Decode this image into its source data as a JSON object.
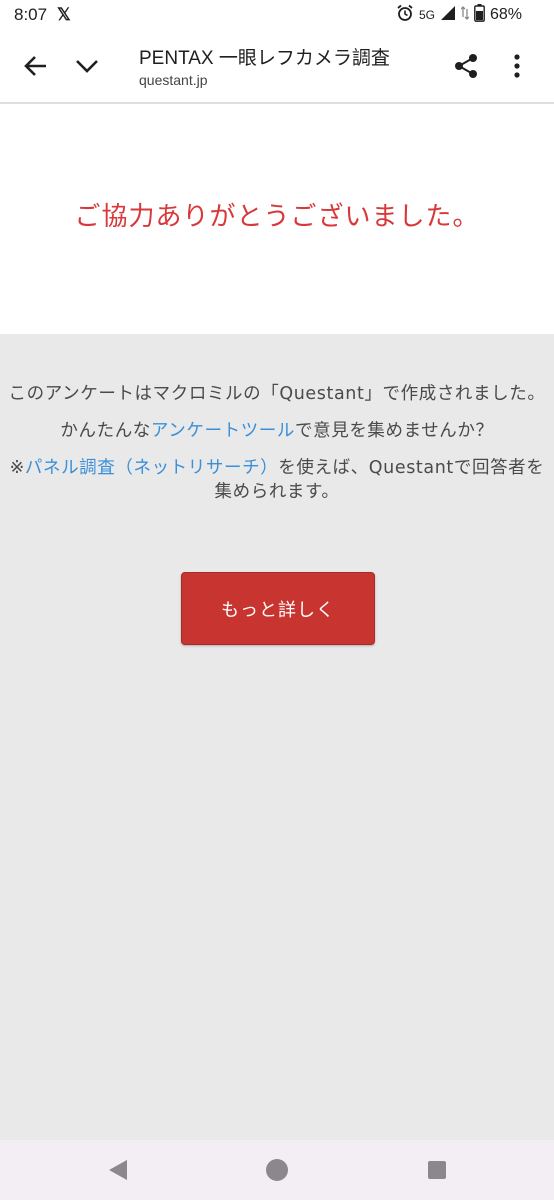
{
  "status_bar": {
    "time": "8:07",
    "x_app": "𝕏",
    "network": "5G",
    "battery": "68%",
    "battery_level": 0.68
  },
  "header": {
    "title": "PENTAX 一眼レフカメラ調査",
    "url": "questant.jp",
    "icons": [
      "arrow-back-icon",
      "chevron-down-icon",
      "share-icon",
      "more-vert-icon"
    ]
  },
  "thanks": {
    "message": "ご協力ありがとうございました。"
  },
  "info": {
    "line1": "このアンケートはマクロミルの「Questant」で作成されました。",
    "line2_pre": "かんたんな",
    "line2_link": "アンケートツール",
    "line2_post": "で意見を集めませんか？",
    "line3_pre": "※",
    "line3_link": "パネル調査（ネットリサーチ）",
    "line3_post": "を使えば、Questantで回答者を集められます。",
    "button_label": "もっと詳しく"
  },
  "colors": {
    "accent_red": "#d9383a",
    "button_red": "#c8342f",
    "link_blue": "#3a8fd9",
    "background": "#e9e9e9"
  },
  "nav_bar": {
    "icons": [
      "nav-back-icon",
      "nav-home-icon",
      "nav-recents-icon"
    ]
  }
}
